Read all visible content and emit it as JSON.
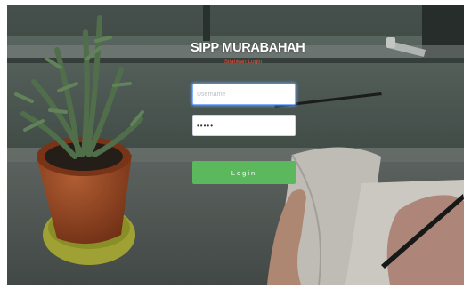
{
  "app": {
    "title": "SIPP MURABAHAH",
    "subtitle": "Silahkan Login"
  },
  "form": {
    "username_placeholder": "Username",
    "username_value": "",
    "password_value": "•••••",
    "login_label": "Login"
  },
  "colors": {
    "title": "#ffffff",
    "subtitle": "#e2543c",
    "login_button": "#5cb85c"
  }
}
